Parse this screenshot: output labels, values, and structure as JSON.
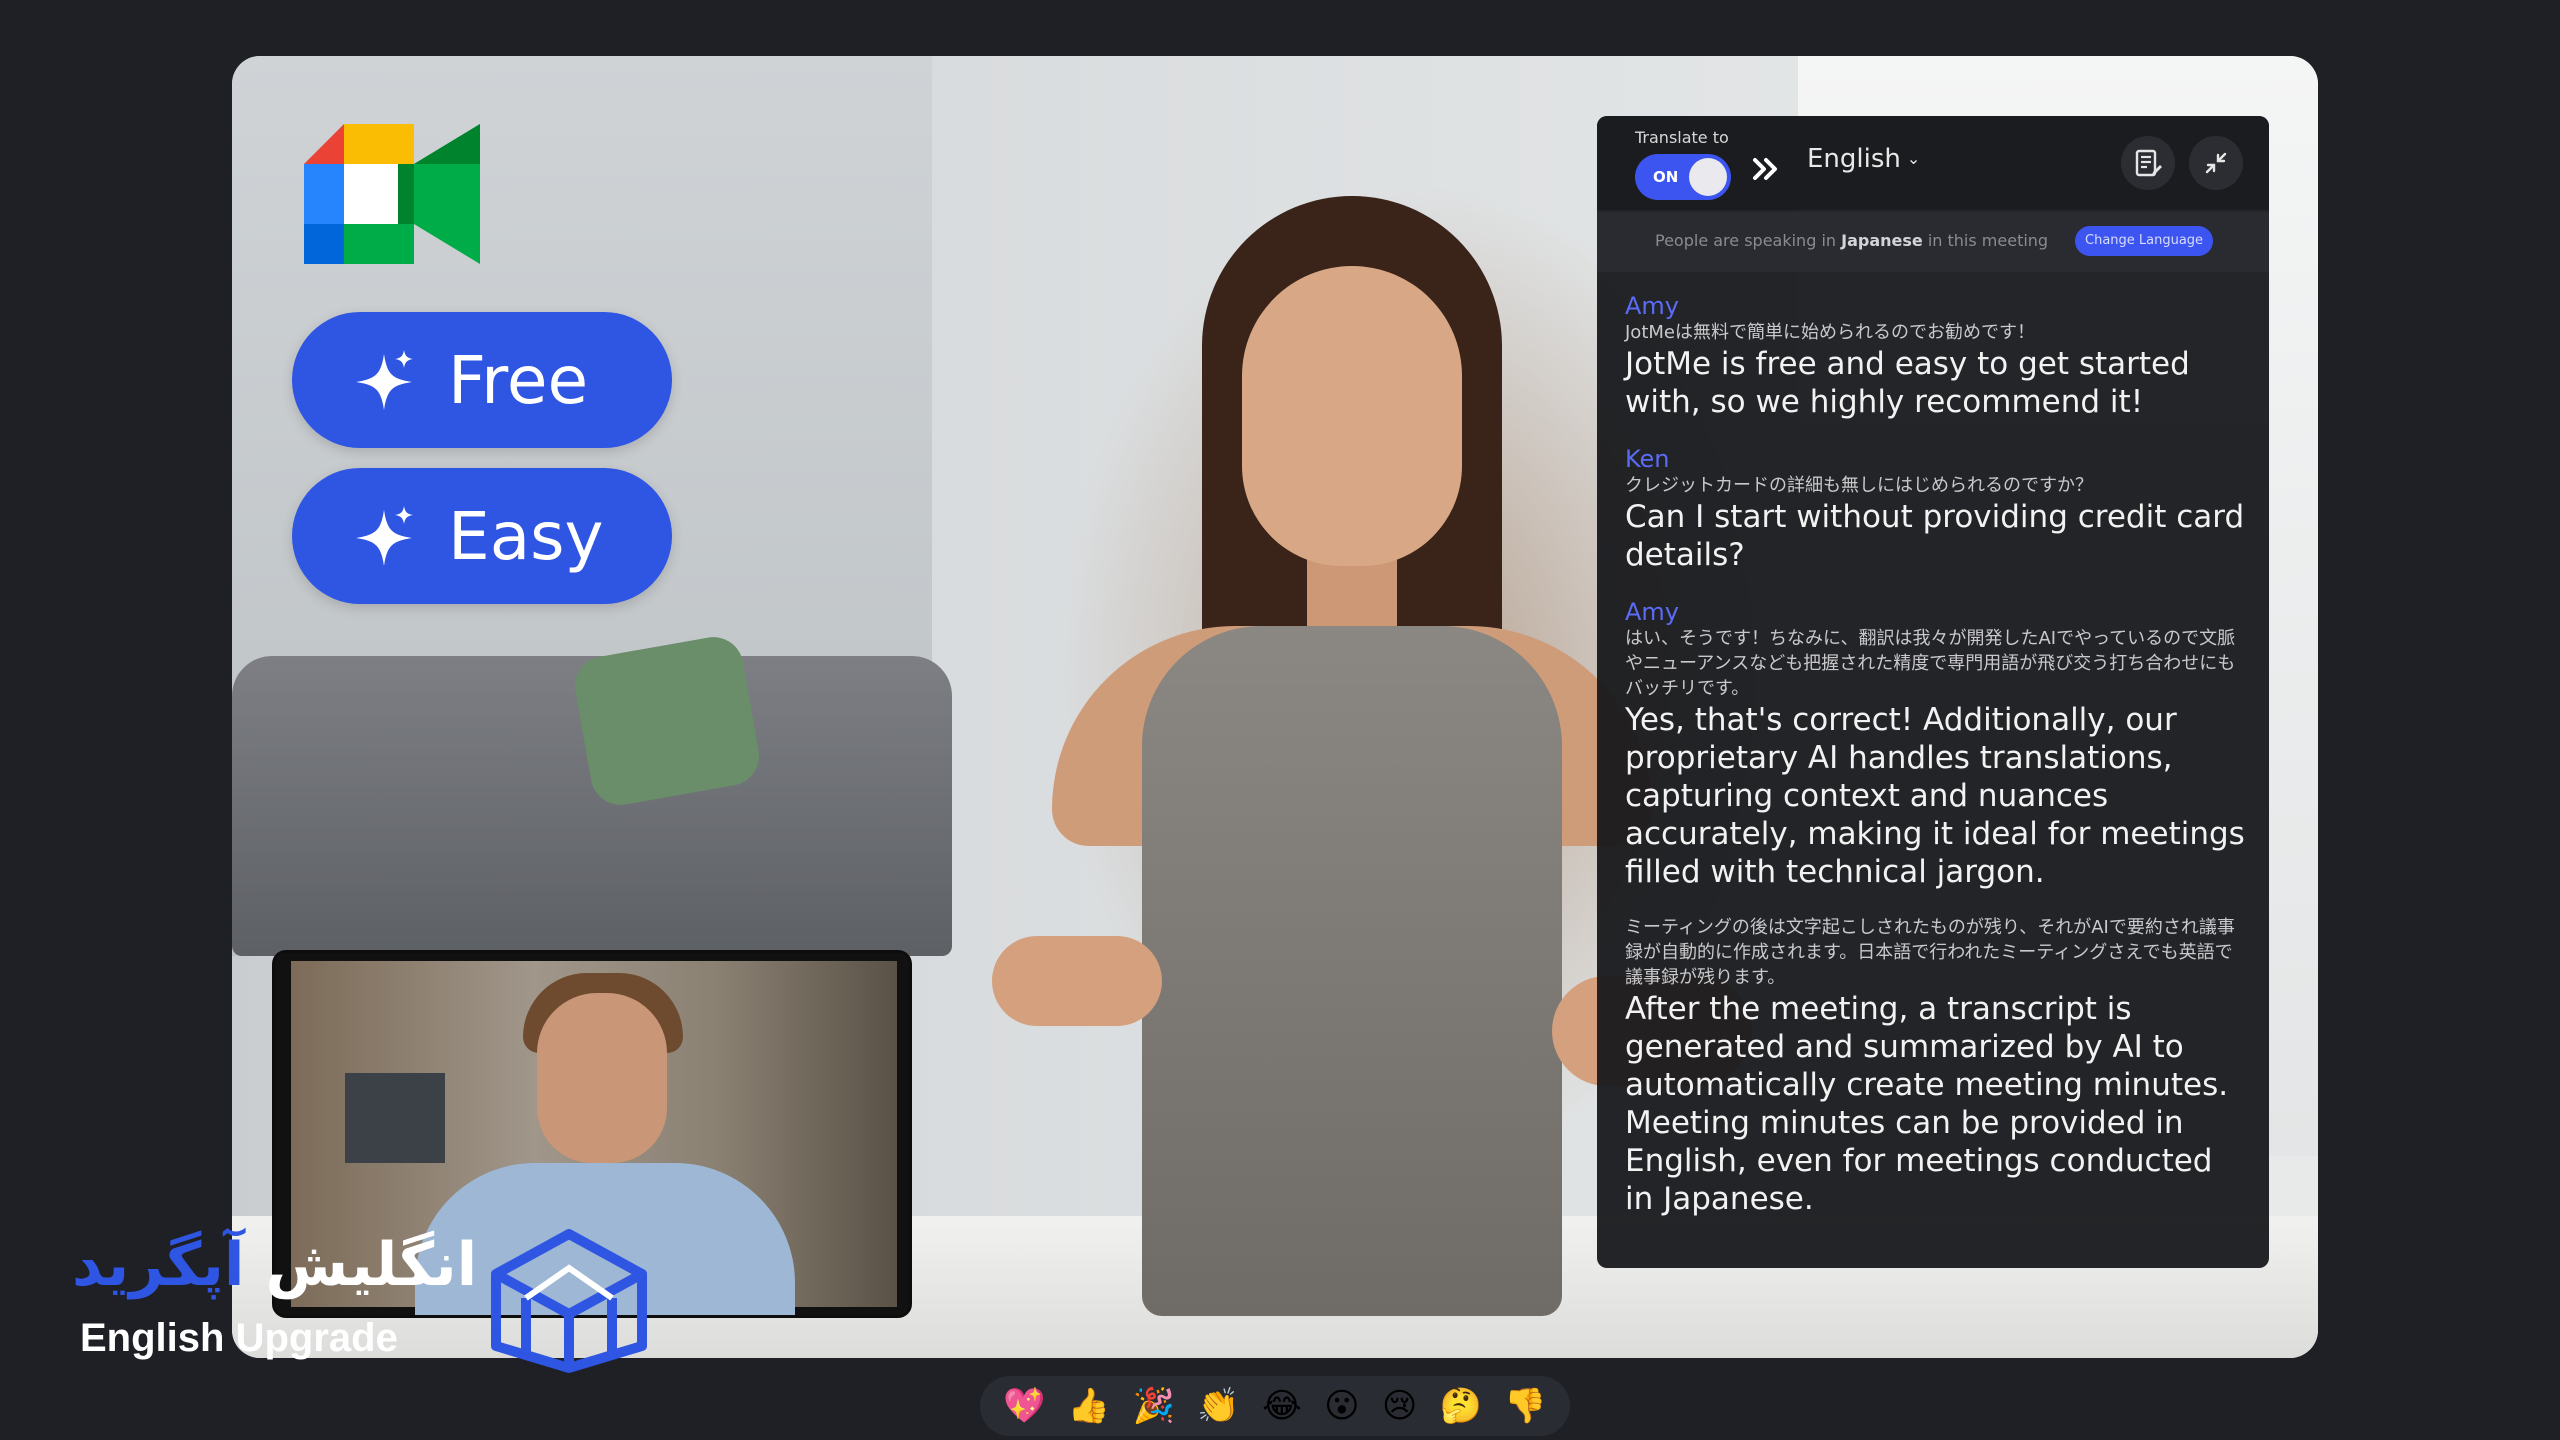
{
  "badges": [
    {
      "label": "Free"
    },
    {
      "label": "Easy"
    }
  ],
  "panel": {
    "translate_to_label": "Translate to",
    "toggle_label": "ON",
    "language": "English",
    "notice_prefix": "People are speaking in",
    "notice_language": "Japanese",
    "notice_suffix": "in this meeting",
    "change_language_label": "Change Language",
    "messages": [
      {
        "speaker": "Amy",
        "jp": "JotMeは無料で簡単に始められるのでお勧めです！",
        "en": "JotMe is free and easy to get started with, so we highly recommend it!"
      },
      {
        "speaker": "Ken",
        "jp": "クレジットカードの詳細も無しにはじめられるのですか？",
        "en": "Can I start without providing credit card details?"
      },
      {
        "speaker": "Amy",
        "jp": "はい、そうです！ちなみに、翻訳は我々が開発したAIでやっているので文脈やニューアンスなども把握された精度で専門用語が飛び交う打ち合わせにもバッチリです。",
        "en": "Yes, that's correct! Additionally, our proprietary AI handles translations, capturing context and nuances accurately, making it ideal for meetings filled with technical jargon."
      },
      {
        "speaker": "",
        "jp": "ミーティングの後は文字起こしされたものが残り、それがAIで要約され議事録が自動的に作成されます。日本語で行われたミーティングさえでも英語で議事録が残ります。",
        "en": "After the meeting, a transcript is generated and summarized by AI to automatically create meeting minutes. Meeting minutes can be provided in English, even for meetings conducted in Japanese."
      }
    ]
  },
  "brand": {
    "fa_part1": "انگلیش",
    "fa_part2": "آپگرید",
    "en": "English Upgrade"
  },
  "reactions": [
    "💖",
    "👍",
    "🎉",
    "👏",
    "😂",
    "😮",
    "😢",
    "🤔",
    "👎"
  ],
  "colors": {
    "accent_blue": "#2f55e3",
    "panel_bg": "#16171b",
    "speaker": "#5b6bf5"
  }
}
